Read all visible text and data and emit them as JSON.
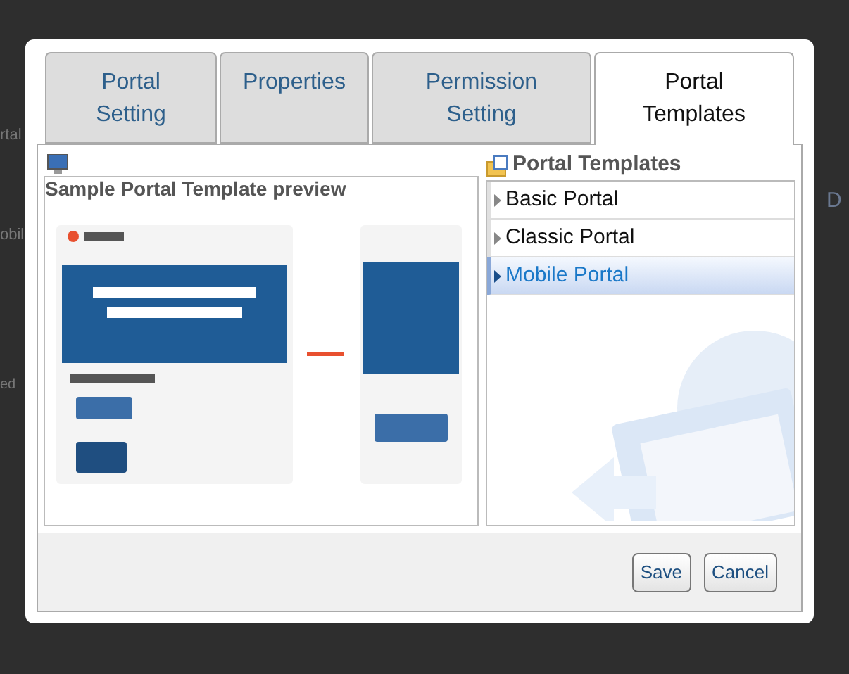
{
  "backdrop_texts": [
    "rtal",
    "obil",
    "D",
    "ed"
  ],
  "tabs": [
    {
      "label": "Portal\nSetting",
      "selected": false
    },
    {
      "label": "Properties",
      "selected": false
    },
    {
      "label": "Permission\nSetting",
      "selected": false
    },
    {
      "label": "Portal\nTemplates",
      "selected": true
    }
  ],
  "preview": {
    "title": "Sample Portal Template preview",
    "kind": "picture"
  },
  "templates": {
    "title": "Portal Templates",
    "items": [
      {
        "label": "Basic Portal",
        "selected": false
      },
      {
        "label": "Classic Portal",
        "selected": false
      },
      {
        "label": "Mobile Portal",
        "selected": true
      }
    ]
  },
  "buttons": [
    "Save",
    "Cancel"
  ]
}
